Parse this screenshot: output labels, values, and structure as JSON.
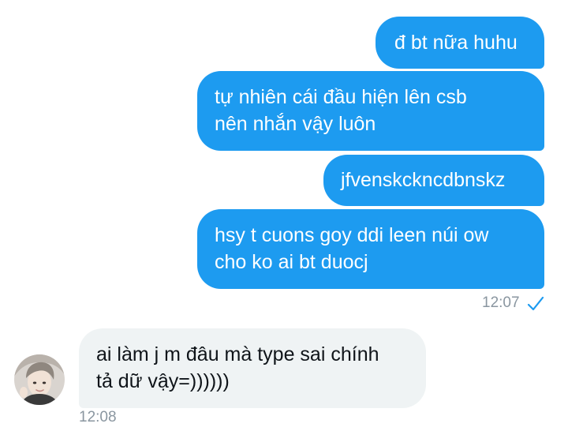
{
  "conversation": {
    "sent_messages": [
      {
        "lines": [
          "đ bt nữa huhu"
        ]
      },
      {
        "lines": [
          "tự nhiên cái đầu hiện lên csb",
          "nên nhắn vậy luôn"
        ]
      },
      {
        "lines": [
          "jfvenskckncdbnskz"
        ]
      },
      {
        "lines": [
          "hsy t cuons goy ddi leen núi ow",
          "cho ko ai bt duocj"
        ]
      }
    ],
    "sent_time": "12:07",
    "sent_status_icon": "check-icon",
    "received_messages": [
      {
        "lines": [
          "ai làm j m đâu mà type sai chính",
          "tả dữ vậy=))))))"
        ]
      }
    ],
    "received_time": "12:08",
    "received_avatar": "avatar-photo"
  },
  "colors": {
    "sent_bubble": "#1d9bf0",
    "received_bubble": "#eff3f4",
    "timestamp": "#8a96a0"
  }
}
